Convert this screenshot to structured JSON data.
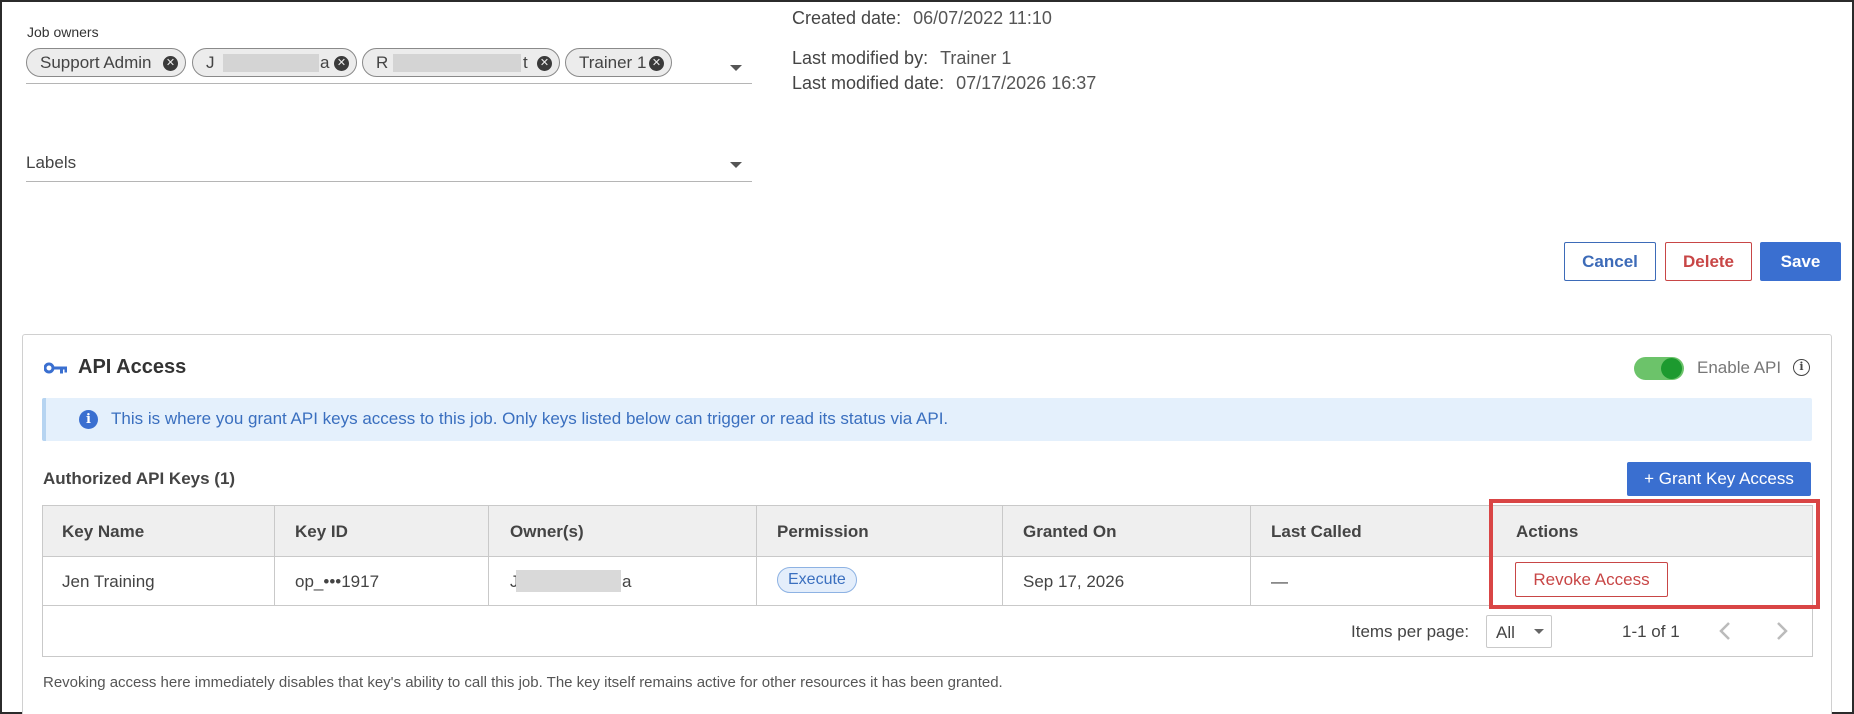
{
  "form": {
    "job_owners_label": "Job owners",
    "owners": [
      {
        "text": "Support Admin"
      },
      {
        "text": "J",
        "tail": "a"
      },
      {
        "text": "R",
        "tail": "t"
      },
      {
        "text": "Trainer 1"
      }
    ],
    "labels_placeholder": "Labels"
  },
  "meta": {
    "created_date_label": "Created date:",
    "created_date": "06/07/2022 11:10",
    "modified_by_label": "Last modified by:",
    "modified_by": "Trainer 1",
    "modified_date_label": "Last modified date:",
    "modified_date": "07/17/2026 16:37"
  },
  "actions": {
    "cancel": "Cancel",
    "delete": "Delete",
    "save": "Save"
  },
  "api": {
    "title": "API Access",
    "enable_label": "Enable API",
    "enabled": true,
    "banner": "This is where you grant API keys access to this job. Only keys listed below can trigger or read its status via API.",
    "subtitle": "Authorized API Keys (1)",
    "grant_button": "+ Grant Key Access",
    "columns": [
      "Key Name",
      "Key ID",
      "Owner(s)",
      "Permission",
      "Granted On",
      "Last Called",
      "Actions"
    ],
    "rows": [
      {
        "key_name": "Jen Training",
        "key_id": "op_•••1917",
        "owner_start": "J",
        "owner_end": "a",
        "permission": "Execute",
        "granted_on": "Sep 17, 2026",
        "last_called": "—",
        "action": "Revoke Access"
      }
    ],
    "pager": {
      "items_per_page_label": "Items per page:",
      "items_per_page": "All",
      "range": "1-1 of 1"
    },
    "footnote": "Revoking access here immediately disables that key's ability to call this job. The key itself remains active for other resources it has been granted."
  }
}
